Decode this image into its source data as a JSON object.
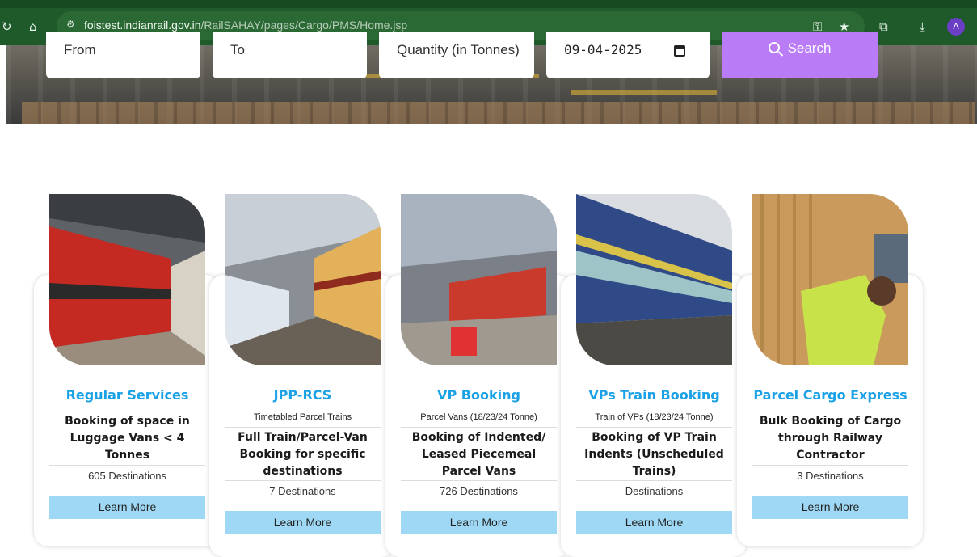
{
  "browser": {
    "reload_icon": "reload-icon",
    "home_icon": "home-icon",
    "url_host": "foistest.indianrail.gov.in",
    "url_path": "/RailSAHAY/pages/Cargo/PMS/Home.jsp",
    "avatar_letter": "A"
  },
  "search": {
    "from_placeholder": "From",
    "to_placeholder": "To",
    "quantity_placeholder": "Quantity (in Tonnes)",
    "date_value": "09-04-2025",
    "search_label": "Search"
  },
  "cards": [
    {
      "title": "Regular Services",
      "subtitle": "",
      "description": "Booking of space in Luggage Vans < 4 Tonnes",
      "destinations": "605 Destinations",
      "cta": "Learn More"
    },
    {
      "title": "JPP-RCS",
      "subtitle": "Timetabled Parcel Trains",
      "description": "Full Train/Parcel-Van Booking for specific destinations",
      "destinations": "7 Destinations",
      "cta": "Learn More"
    },
    {
      "title": "VP Booking",
      "subtitle": "Parcel Vans (18/23/24 Tonne)",
      "description": "Booking of Indented/ Leased Piecemeal Parcel Vans",
      "destinations": "726 Destinations",
      "cta": "Learn More"
    },
    {
      "title": "VPs Train Booking",
      "subtitle": "Train of VPs (18/23/24 Tonne)",
      "description": "Booking of VP Train Indents (Unscheduled Trains)",
      "destinations": "Destinations",
      "cta": "Learn More"
    },
    {
      "title": "Parcel Cargo Express",
      "subtitle": "",
      "description": "Bulk Booking of Cargo through Railway Contractor",
      "destinations": "3 Destinations",
      "cta": "Learn More"
    }
  ],
  "colors": {
    "accent": "#1aa1e6",
    "button": "#9ed8f5",
    "search": "#b97cf6",
    "browser": "#1f5a2a"
  }
}
